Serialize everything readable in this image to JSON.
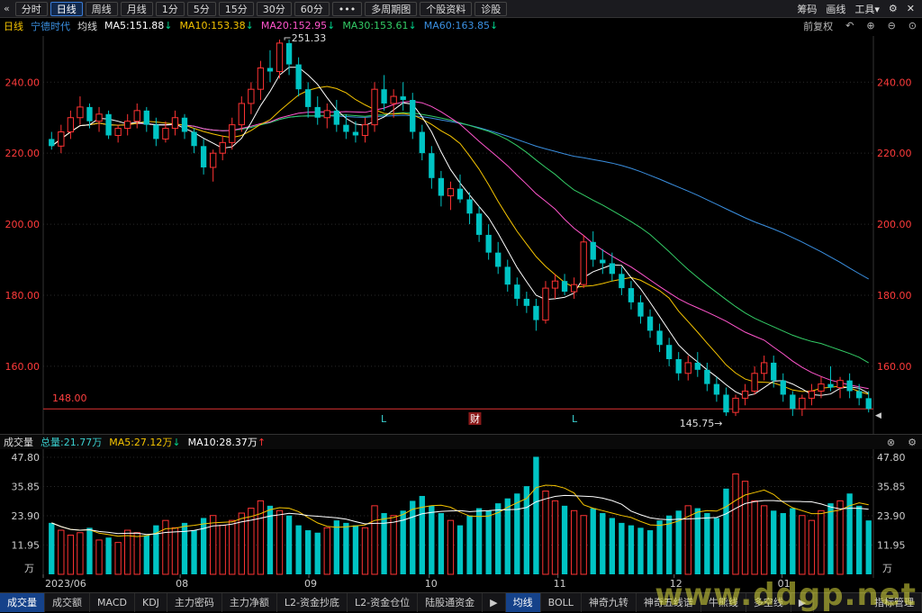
{
  "toolbar": {
    "back_icon": "double-chevron-left-icon",
    "tabs": [
      {
        "label": "分时",
        "active": false
      },
      {
        "label": "日线",
        "active": true
      },
      {
        "label": "周线",
        "active": false
      },
      {
        "label": "月线",
        "active": false
      },
      {
        "label": "1分",
        "active": false
      },
      {
        "label": "5分",
        "active": false
      },
      {
        "label": "15分",
        "active": false
      },
      {
        "label": "30分",
        "active": false
      },
      {
        "label": "60分",
        "active": false
      },
      {
        "label": "•••",
        "active": false
      },
      {
        "label": "多周期图",
        "active": false
      },
      {
        "label": "个股资料",
        "active": false
      },
      {
        "label": "诊股",
        "active": false
      }
    ],
    "right": [
      "筹码",
      "画线",
      "工具▾"
    ],
    "gear_icon": "gear-icon",
    "close_icon": "close-icon"
  },
  "ma_line": {
    "period": "日线",
    "stock_name": "宁德时代",
    "type": "均线",
    "ma5": "MA5:151.88",
    "ma10": "MA10:153.38",
    "ma20": "MA20:152.95",
    "ma30": "MA30:153.61",
    "ma60": "MA60:163.85",
    "rights": "前复权"
  },
  "colors": {
    "up": "#ff3333",
    "down": "#00c4c4",
    "ma5": "#ffffff",
    "ma10": "#f5c400",
    "ma20": "#ff55cc",
    "ma30": "#33cc66",
    "ma60": "#3a8fe0",
    "axis_text": "#ff3b3b",
    "grid": "#2a2a2a"
  },
  "chart_data": {
    "type": "candlestick",
    "price_axis": {
      "ticks": [
        "240.00",
        "220.00",
        "200.00",
        "180.00",
        "160.00"
      ],
      "ylim": [
        144,
        253
      ]
    },
    "x_ticks": [
      "2023/06",
      "08",
      "09",
      "10",
      "11",
      "12",
      "01"
    ],
    "annotations": {
      "high": "251.33",
      "low": "145.75",
      "hline": "148.00",
      "markers": [
        "L",
        "财",
        "L"
      ]
    },
    "ohlc": [
      [
        224,
        226,
        221,
        222
      ],
      [
        222,
        228,
        220,
        226
      ],
      [
        226,
        232,
        224,
        230
      ],
      [
        230,
        236,
        228,
        233
      ],
      [
        233,
        234,
        227,
        229
      ],
      [
        229,
        233,
        226,
        231
      ],
      [
        231,
        232,
        224,
        225
      ],
      [
        225,
        228,
        223,
        227
      ],
      [
        227,
        231,
        225,
        229
      ],
      [
        229,
        234,
        227,
        232
      ],
      [
        232,
        233,
        226,
        228
      ],
      [
        228,
        230,
        222,
        224
      ],
      [
        224,
        229,
        223,
        227
      ],
      [
        227,
        232,
        225,
        230
      ],
      [
        230,
        231,
        224,
        226
      ],
      [
        226,
        227,
        220,
        222
      ],
      [
        222,
        224,
        214,
        216
      ],
      [
        216,
        221,
        212,
        220
      ],
      [
        220,
        225,
        218,
        223
      ],
      [
        223,
        230,
        221,
        228
      ],
      [
        228,
        236,
        226,
        234
      ],
      [
        234,
        240,
        231,
        238
      ],
      [
        238,
        246,
        235,
        244
      ],
      [
        244,
        249,
        240,
        243
      ],
      [
        243,
        252,
        241,
        251
      ],
      [
        251,
        252,
        242,
        245
      ],
      [
        245,
        247,
        236,
        238
      ],
      [
        238,
        240,
        230,
        233
      ],
      [
        233,
        236,
        228,
        230
      ],
      [
        230,
        234,
        227,
        232
      ],
      [
        232,
        235,
        226,
        228
      ],
      [
        228,
        231,
        224,
        226
      ],
      [
        226,
        229,
        223,
        225
      ],
      [
        225,
        230,
        223,
        228
      ],
      [
        228,
        240,
        226,
        238
      ],
      [
        238,
        242,
        232,
        234
      ],
      [
        234,
        238,
        230,
        236
      ],
      [
        236,
        240,
        232,
        235
      ],
      [
        235,
        237,
        224,
        226
      ],
      [
        226,
        228,
        218,
        220
      ],
      [
        220,
        222,
        210,
        213
      ],
      [
        213,
        215,
        205,
        208
      ],
      [
        208,
        212,
        204,
        210
      ],
      [
        210,
        214,
        206,
        207
      ],
      [
        207,
        209,
        200,
        203
      ],
      [
        203,
        205,
        195,
        197
      ],
      [
        197,
        200,
        190,
        192
      ],
      [
        192,
        195,
        186,
        188
      ],
      [
        188,
        190,
        181,
        183
      ],
      [
        183,
        185,
        177,
        179
      ],
      [
        179,
        181,
        175,
        177
      ],
      [
        177,
        179,
        170,
        173
      ],
      [
        173,
        184,
        172,
        182
      ],
      [
        182,
        186,
        179,
        184
      ],
      [
        184,
        186,
        180,
        181
      ],
      [
        181,
        185,
        179,
        183
      ],
      [
        183,
        197,
        182,
        195
      ],
      [
        195,
        198,
        188,
        190
      ],
      [
        190,
        193,
        186,
        189
      ],
      [
        189,
        192,
        184,
        186
      ],
      [
        186,
        188,
        180,
        182
      ],
      [
        182,
        184,
        176,
        178
      ],
      [
        178,
        180,
        172,
        174
      ],
      [
        174,
        176,
        168,
        170
      ],
      [
        170,
        172,
        164,
        166
      ],
      [
        166,
        168,
        160,
        162
      ],
      [
        162,
        164,
        156,
        158
      ],
      [
        158,
        163,
        156,
        161
      ],
      [
        161,
        164,
        157,
        159
      ],
      [
        159,
        161,
        153,
        155
      ],
      [
        155,
        157,
        150,
        152
      ],
      [
        152,
        154,
        146,
        147
      ],
      [
        147,
        152,
        146,
        151
      ],
      [
        151,
        155,
        149,
        153
      ],
      [
        153,
        160,
        152,
        158
      ],
      [
        158,
        163,
        156,
        161
      ],
      [
        161,
        163,
        154,
        156
      ],
      [
        156,
        158,
        150,
        152
      ],
      [
        152,
        153,
        146,
        148
      ],
      [
        148,
        152,
        146,
        151
      ],
      [
        151,
        155,
        149,
        153
      ],
      [
        153,
        157,
        151,
        155
      ],
      [
        155,
        160,
        153,
        154
      ],
      [
        154,
        157,
        151,
        156
      ],
      [
        156,
        158,
        151,
        153
      ],
      [
        153,
        155,
        149,
        151
      ],
      [
        151,
        153,
        147,
        148
      ]
    ],
    "volume": {
      "ticks": [
        "47.80",
        "35.85",
        "23.90",
        "11.95"
      ],
      "unit": "万",
      "total": "总量:21.77万",
      "ma5": "MA5:27.12万",
      "ma10": "MA10:28.37万",
      "values": [
        21,
        18,
        16,
        17,
        19,
        14,
        15,
        13,
        18,
        17,
        16,
        20,
        22,
        19,
        21,
        18,
        23,
        24,
        20,
        22,
        25,
        27,
        30,
        28,
        26,
        24,
        20,
        18,
        17,
        19,
        22,
        21,
        20,
        19,
        28,
        25,
        24,
        26,
        30,
        32,
        28,
        25,
        22,
        20,
        24,
        27,
        26,
        29,
        31,
        33,
        36,
        48,
        34,
        30,
        28,
        26,
        24,
        27,
        25,
        23,
        21,
        20,
        19,
        18,
        22,
        24,
        26,
        28,
        27,
        25,
        23,
        35,
        41,
        38,
        30,
        28,
        26,
        25,
        27,
        24,
        22,
        26,
        29,
        30,
        33,
        28,
        22
      ]
    }
  },
  "volume_header": {
    "label": "成交量",
    "close_icon": "close-icon",
    "settings_icon": "gear-icon"
  },
  "bottom_tabs": [
    {
      "label": "成交量",
      "active": true
    },
    {
      "label": "成交额",
      "active": false
    },
    {
      "label": "MACD",
      "active": false
    },
    {
      "label": "KDJ",
      "active": false
    },
    {
      "label": "主力密码",
      "active": false
    },
    {
      "label": "主力净额",
      "active": false
    },
    {
      "label": "L2-资金抄底",
      "active": false
    },
    {
      "label": "L2-资金仓位",
      "active": false
    },
    {
      "label": "陆股通资金",
      "active": false
    },
    {
      "label": "▶",
      "active": false
    },
    {
      "label": "均线",
      "active": true
    },
    {
      "label": "BOLL",
      "active": false
    },
    {
      "label": "神奇九转",
      "active": false
    },
    {
      "label": "神奇五线谱",
      "active": false
    },
    {
      "label": "牛熊线",
      "active": false
    },
    {
      "label": "多空线",
      "active": false
    },
    {
      "label": "▶",
      "active": false
    },
    {
      "label": "指标管理",
      "active": false
    }
  ],
  "watermark": "www.ddgp.net"
}
